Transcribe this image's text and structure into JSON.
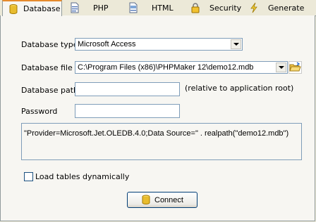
{
  "tabs": [
    {
      "label": "Database",
      "icon": "database-icon",
      "active": true
    },
    {
      "label": "PHP",
      "icon": "php-file-icon"
    },
    {
      "label": "HTML",
      "icon": "html-file-icon"
    },
    {
      "label": "Security",
      "icon": "lock-icon"
    },
    {
      "label": "Generate",
      "icon": "lightning-icon"
    }
  ],
  "form": {
    "db_type_label": "Database type",
    "db_type_value": "Microsoft Access",
    "db_file_label": "Database file",
    "db_file_value": "C:\\Program Files (x86)\\PHPMaker 12\\demo12.mdb",
    "db_path_label": "Database path",
    "db_path_value": "",
    "db_path_hint": "(relative to application root)",
    "password_label": "Password",
    "password_value": "",
    "connection_string": "\"Provider=Microsoft.Jet.OLEDB.4.0;Data Source=\" . realpath(\"demo12.mdb\")",
    "load_tables_label": "Load tables dynamically",
    "load_tables_checked": false,
    "connect_label": "Connect"
  },
  "colors": {
    "active_tab_accent": "#e68b2c",
    "field_border": "#7f9db9",
    "button_border": "#003c74"
  }
}
